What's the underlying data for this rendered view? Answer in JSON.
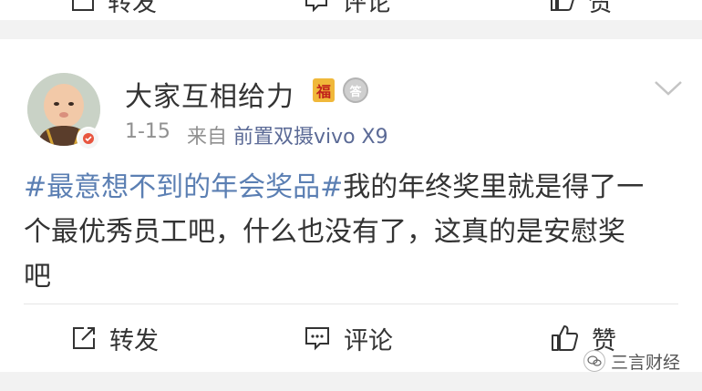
{
  "prev_post": {
    "repost_label": "转发",
    "comment_label": "评论",
    "like_label": "赞"
  },
  "post": {
    "username": "大家互相给力",
    "fu_badge": "福",
    "medal_text": "答",
    "date": "1-15",
    "source_prefix": "来自",
    "device": "前置双摄vivo X9",
    "lines": [
      {
        "topic": "#最意想不到的年会奖品#",
        "text": "我的年终奖里就是得了一"
      },
      {
        "topic": "",
        "text": "个最优秀员工吧，什么也没有了，这真的是安慰奖"
      },
      {
        "topic": "",
        "text": "吧"
      }
    ]
  },
  "actions": {
    "repost_label": "转发",
    "comment_label": "评论",
    "like_label": "赞"
  },
  "watermark": {
    "text": "三言财经"
  },
  "colors": {
    "topic_link": "#5b7fb3",
    "device_link": "#5b6a96",
    "background": "#f2f2f2",
    "card": "#ffffff"
  }
}
